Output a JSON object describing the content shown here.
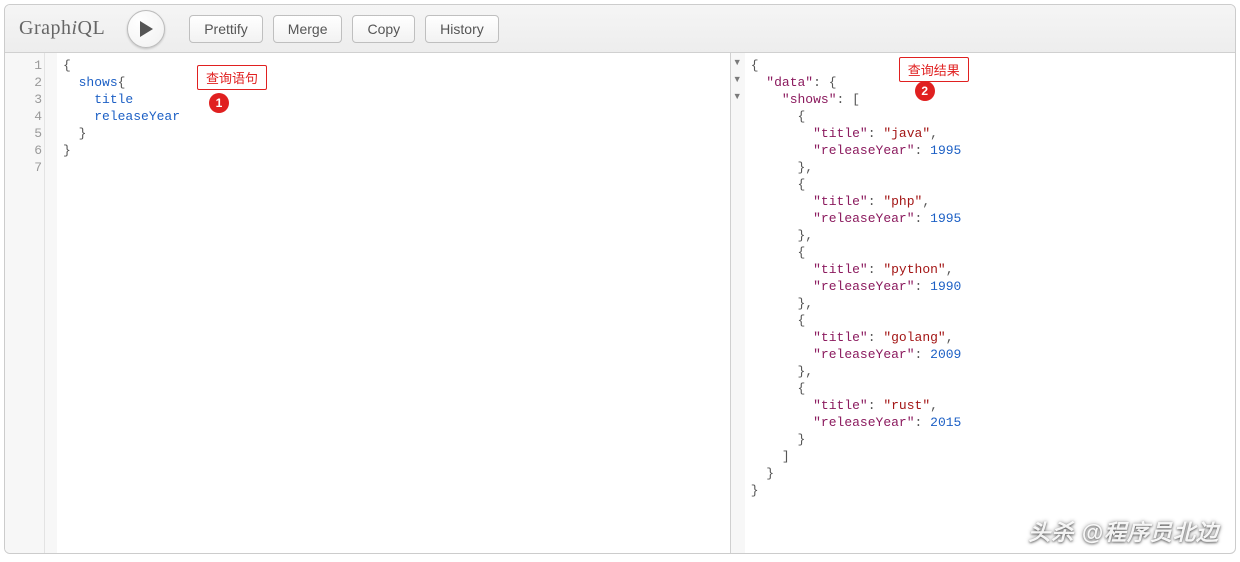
{
  "toolbar": {
    "logo_prefix": "Graph",
    "logo_i": "i",
    "logo_suffix": "QL",
    "prettify": "Prettify",
    "merge": "Merge",
    "copy": "Copy",
    "history": "History"
  },
  "editor": {
    "lines": [
      "1",
      "2",
      "3",
      "4",
      "5",
      "6",
      "7"
    ],
    "query_tokens": [
      [
        {
          "t": "{",
          "c": "punc"
        }
      ],
      [
        {
          "t": "  ",
          "c": ""
        },
        {
          "t": "shows",
          "c": "kw-def"
        },
        {
          "t": "{",
          "c": "punc"
        }
      ],
      [
        {
          "t": "    ",
          "c": ""
        },
        {
          "t": "title",
          "c": "kw-def"
        }
      ],
      [
        {
          "t": "    ",
          "c": ""
        },
        {
          "t": "releaseYear",
          "c": "kw-def"
        }
      ],
      [
        {
          "t": "  ",
          "c": ""
        },
        {
          "t": "}",
          "c": "punc"
        }
      ],
      [
        {
          "t": "}",
          "c": "punc"
        }
      ],
      [
        {
          "t": "",
          "c": ""
        }
      ]
    ]
  },
  "result": {
    "tokens": [
      [
        {
          "t": "{",
          "c": "punc"
        }
      ],
      [
        {
          "t": "  ",
          "c": ""
        },
        {
          "t": "\"data\"",
          "c": "j-key"
        },
        {
          "t": ": {",
          "c": "punc"
        }
      ],
      [
        {
          "t": "    ",
          "c": ""
        },
        {
          "t": "\"shows\"",
          "c": "j-key"
        },
        {
          "t": ": [",
          "c": "punc"
        }
      ],
      [
        {
          "t": "      {",
          "c": "punc"
        }
      ],
      [
        {
          "t": "        ",
          "c": ""
        },
        {
          "t": "\"title\"",
          "c": "j-key"
        },
        {
          "t": ": ",
          "c": "punc"
        },
        {
          "t": "\"java\"",
          "c": "j-str"
        },
        {
          "t": ",",
          "c": "punc"
        }
      ],
      [
        {
          "t": "        ",
          "c": ""
        },
        {
          "t": "\"releaseYear\"",
          "c": "j-key"
        },
        {
          "t": ": ",
          "c": "punc"
        },
        {
          "t": "1995",
          "c": "j-num"
        }
      ],
      [
        {
          "t": "      },",
          "c": "punc"
        }
      ],
      [
        {
          "t": "      {",
          "c": "punc"
        }
      ],
      [
        {
          "t": "        ",
          "c": ""
        },
        {
          "t": "\"title\"",
          "c": "j-key"
        },
        {
          "t": ": ",
          "c": "punc"
        },
        {
          "t": "\"php\"",
          "c": "j-str"
        },
        {
          "t": ",",
          "c": "punc"
        }
      ],
      [
        {
          "t": "        ",
          "c": ""
        },
        {
          "t": "\"releaseYear\"",
          "c": "j-key"
        },
        {
          "t": ": ",
          "c": "punc"
        },
        {
          "t": "1995",
          "c": "j-num"
        }
      ],
      [
        {
          "t": "      },",
          "c": "punc"
        }
      ],
      [
        {
          "t": "      {",
          "c": "punc"
        }
      ],
      [
        {
          "t": "        ",
          "c": ""
        },
        {
          "t": "\"title\"",
          "c": "j-key"
        },
        {
          "t": ": ",
          "c": "punc"
        },
        {
          "t": "\"python\"",
          "c": "j-str"
        },
        {
          "t": ",",
          "c": "punc"
        }
      ],
      [
        {
          "t": "        ",
          "c": ""
        },
        {
          "t": "\"releaseYear\"",
          "c": "j-key"
        },
        {
          "t": ": ",
          "c": "punc"
        },
        {
          "t": "1990",
          "c": "j-num"
        }
      ],
      [
        {
          "t": "      },",
          "c": "punc"
        }
      ],
      [
        {
          "t": "      {",
          "c": "punc"
        }
      ],
      [
        {
          "t": "        ",
          "c": ""
        },
        {
          "t": "\"title\"",
          "c": "j-key"
        },
        {
          "t": ": ",
          "c": "punc"
        },
        {
          "t": "\"golang\"",
          "c": "j-str"
        },
        {
          "t": ",",
          "c": "punc"
        }
      ],
      [
        {
          "t": "        ",
          "c": ""
        },
        {
          "t": "\"releaseYear\"",
          "c": "j-key"
        },
        {
          "t": ": ",
          "c": "punc"
        },
        {
          "t": "2009",
          "c": "j-num"
        }
      ],
      [
        {
          "t": "      },",
          "c": "punc"
        }
      ],
      [
        {
          "t": "      {",
          "c": "punc"
        }
      ],
      [
        {
          "t": "        ",
          "c": ""
        },
        {
          "t": "\"title\"",
          "c": "j-key"
        },
        {
          "t": ": ",
          "c": "punc"
        },
        {
          "t": "\"rust\"",
          "c": "j-str"
        },
        {
          "t": ",",
          "c": "punc"
        }
      ],
      [
        {
          "t": "        ",
          "c": ""
        },
        {
          "t": "\"releaseYear\"",
          "c": "j-key"
        },
        {
          "t": ": ",
          "c": "punc"
        },
        {
          "t": "2015",
          "c": "j-num"
        }
      ],
      [
        {
          "t": "      }",
          "c": "punc"
        }
      ],
      [
        {
          "t": "    ]",
          "c": "punc"
        }
      ],
      [
        {
          "t": "  }",
          "c": "punc"
        }
      ],
      [
        {
          "t": "}",
          "c": "punc"
        }
      ]
    ]
  },
  "annotations": {
    "query_label": "查询语句",
    "query_num": "1",
    "result_label": "查询结果",
    "result_num": "2"
  },
  "watermark": "头杀 @程序员北边"
}
